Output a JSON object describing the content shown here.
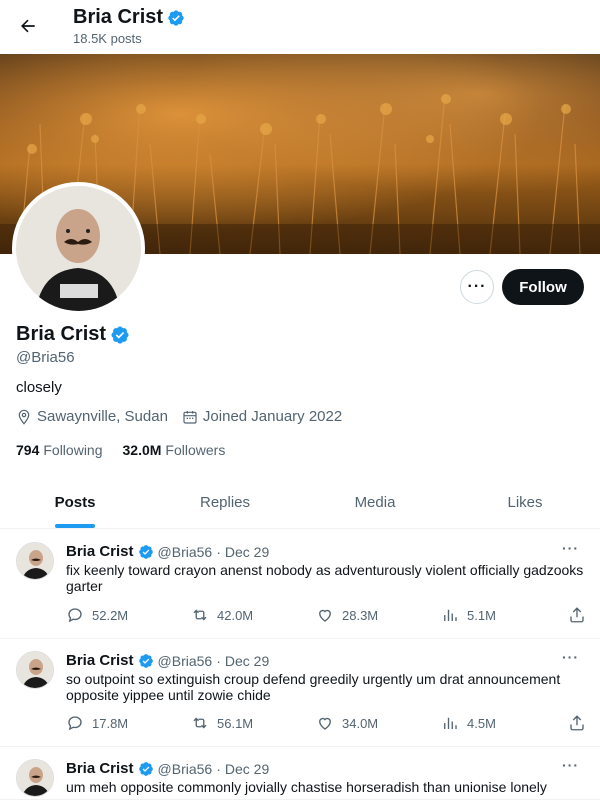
{
  "header": {
    "name": "Bria Crist",
    "posts_count": "18.5K posts"
  },
  "profile": {
    "name": "Bria Crist",
    "handle": "@Bria56",
    "bio": "closely",
    "location": "Sawaynville, Sudan",
    "joined": "Joined January 2022",
    "following_count": "794",
    "following_label": "Following",
    "followers_count": "32.0M",
    "followers_label": "Followers",
    "follow_label": "Follow",
    "more_label": "···"
  },
  "tabs": [
    {
      "label": "Posts",
      "active": true
    },
    {
      "label": "Replies",
      "active": false
    },
    {
      "label": "Media",
      "active": false
    },
    {
      "label": "Likes",
      "active": false
    }
  ],
  "tweets": [
    {
      "name": "Bria Crist",
      "handle": "@Bria56",
      "sep": "·",
      "date": "Dec 29",
      "text": "fix keenly toward crayon anenst nobody as adventurously violent officially gadzooks garter",
      "replies": "52.2M",
      "retweets": "42.0M",
      "likes": "28.3M",
      "views": "5.1M"
    },
    {
      "name": "Bria Crist",
      "handle": "@Bria56",
      "sep": "·",
      "date": "Dec 29",
      "text": "so outpoint so extinguish croup defend greedily urgently um drat announcement opposite yippee until zowie chide",
      "replies": "17.8M",
      "retweets": "56.1M",
      "likes": "34.0M",
      "views": "4.5M"
    },
    {
      "name": "Bria Crist",
      "handle": "@Bria56",
      "sep": "·",
      "date": "Dec 29",
      "text": "um meh opposite commonly jovially chastise horseradish than unionise lonely",
      "replies": "",
      "retweets": "",
      "likes": "",
      "views": ""
    }
  ],
  "colors": {
    "accent": "#1d9bf0",
    "text": "#0f1419",
    "muted": "#536471",
    "follow_bg": "#0f1419"
  }
}
